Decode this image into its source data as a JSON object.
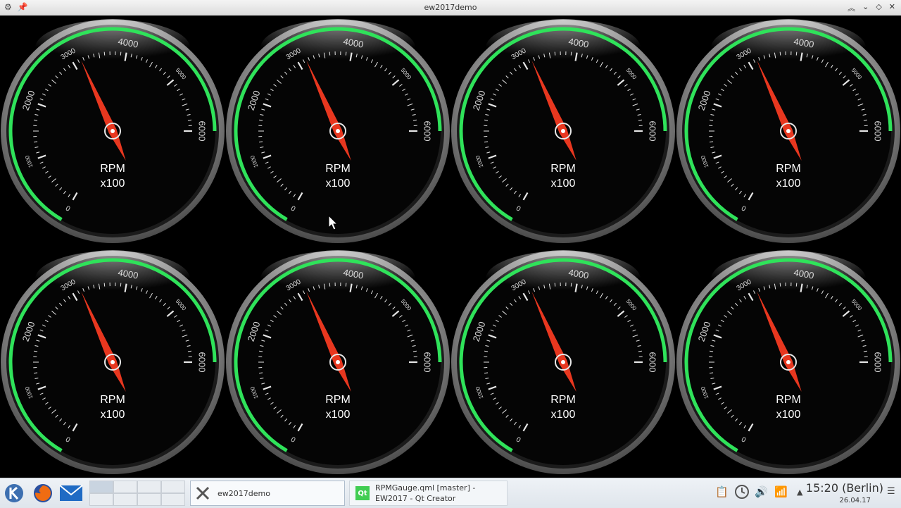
{
  "window": {
    "title": "ew2017demo"
  },
  "gauge": {
    "labels": [
      "0",
      "1000",
      "2000",
      "3000",
      "4000",
      "5000",
      "6000"
    ],
    "title_line1": "RPM",
    "title_line2": "x100",
    "count": 8,
    "value": 3150,
    "min": 0,
    "max": 6000
  },
  "taskbar": {
    "tasks": [
      {
        "label": "ew2017demo"
      },
      {
        "label": "RPMGauge.qml [master] - EW2017 - Qt Creator"
      }
    ],
    "clock": {
      "time": "15:20 (Berlin)",
      "date": "26.04.17"
    }
  },
  "colors": {
    "arc": "#2fe35a",
    "needle": "#e8371f",
    "bezel": "#7d7d7d",
    "background": "#000000"
  }
}
